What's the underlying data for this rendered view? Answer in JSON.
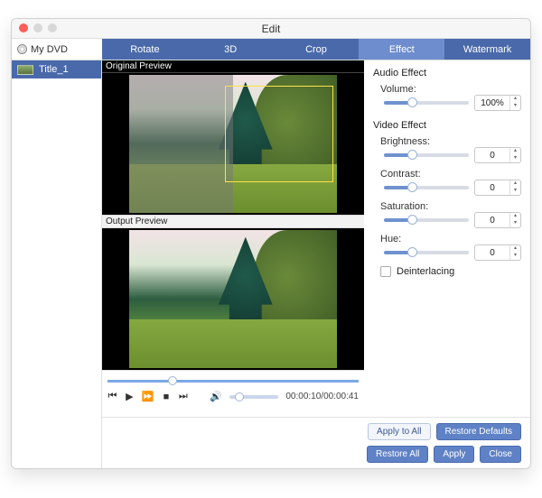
{
  "window_title": "Edit",
  "source_name": "My DVD",
  "sidebar": {
    "items": [
      {
        "label": "Title_1"
      }
    ]
  },
  "tabs": {
    "rotate": "Rotate",
    "threeD": "3D",
    "crop": "Crop",
    "effect": "Effect",
    "watermark": "Watermark",
    "active": "effect"
  },
  "preview": {
    "original_label": "Original Preview",
    "output_label": "Output Preview"
  },
  "playback": {
    "current": "00:00:10",
    "total": "00:00:41",
    "display": "00:00:10/00:00:41"
  },
  "effects": {
    "audio_title": "Audio Effect",
    "volume_label": "Volume:",
    "volume_value": "100%",
    "video_title": "Video Effect",
    "brightness_label": "Brightness:",
    "brightness_value": "0",
    "contrast_label": "Contrast:",
    "contrast_value": "0",
    "saturation_label": "Saturation:",
    "saturation_value": "0",
    "hue_label": "Hue:",
    "hue_value": "0",
    "deinterlace_label": "Deinterlacing",
    "deinterlace_checked": false
  },
  "buttons": {
    "apply_all": "Apply to All",
    "restore_defaults": "Restore Defaults",
    "restore_all": "Restore All",
    "apply": "Apply",
    "close": "Close"
  }
}
